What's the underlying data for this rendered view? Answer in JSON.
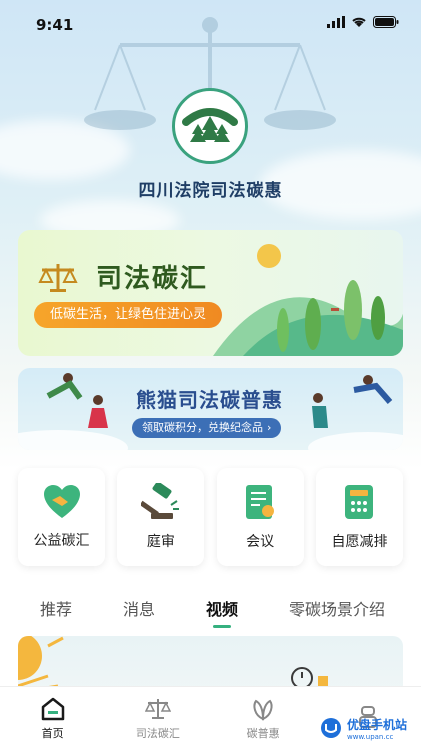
{
  "status": {
    "time": "9:41"
  },
  "header": {
    "title": "四川法院司法碳惠"
  },
  "banner_carbon": {
    "title": "司法碳汇",
    "slogan": "低碳生活，让绿色住进心灵"
  },
  "banner_panda": {
    "title": "熊猫司法碳普惠",
    "cta": "领取碳积分，兑换纪念品"
  },
  "grid": [
    {
      "label": "公益碳汇",
      "icon": "handshake-icon"
    },
    {
      "label": "庭审",
      "icon": "gavel-icon"
    },
    {
      "label": "会议",
      "icon": "document-icon"
    },
    {
      "label": "自愿减排",
      "icon": "calculator-icon"
    }
  ],
  "tabs": [
    {
      "label": "推荐",
      "active": false
    },
    {
      "label": "消息",
      "active": false
    },
    {
      "label": "视频",
      "active": true
    },
    {
      "label": "零碳场景介绍",
      "active": false
    }
  ],
  "bottom_nav": [
    {
      "label": "首页",
      "icon": "home-icon",
      "active": true
    },
    {
      "label": "司法碳汇",
      "icon": "scale-icon",
      "active": false
    },
    {
      "label": "碳普惠",
      "icon": "leaf-icon",
      "active": false
    },
    {
      "label": "",
      "icon": "profile-icon",
      "active": false
    }
  ],
  "watermark": {
    "text": "优盘手机站",
    "url": "www.upan.cc"
  },
  "colors": {
    "accent": "#35b07f",
    "brand_blue": "#1f3e66",
    "orange": "#f08a22"
  }
}
